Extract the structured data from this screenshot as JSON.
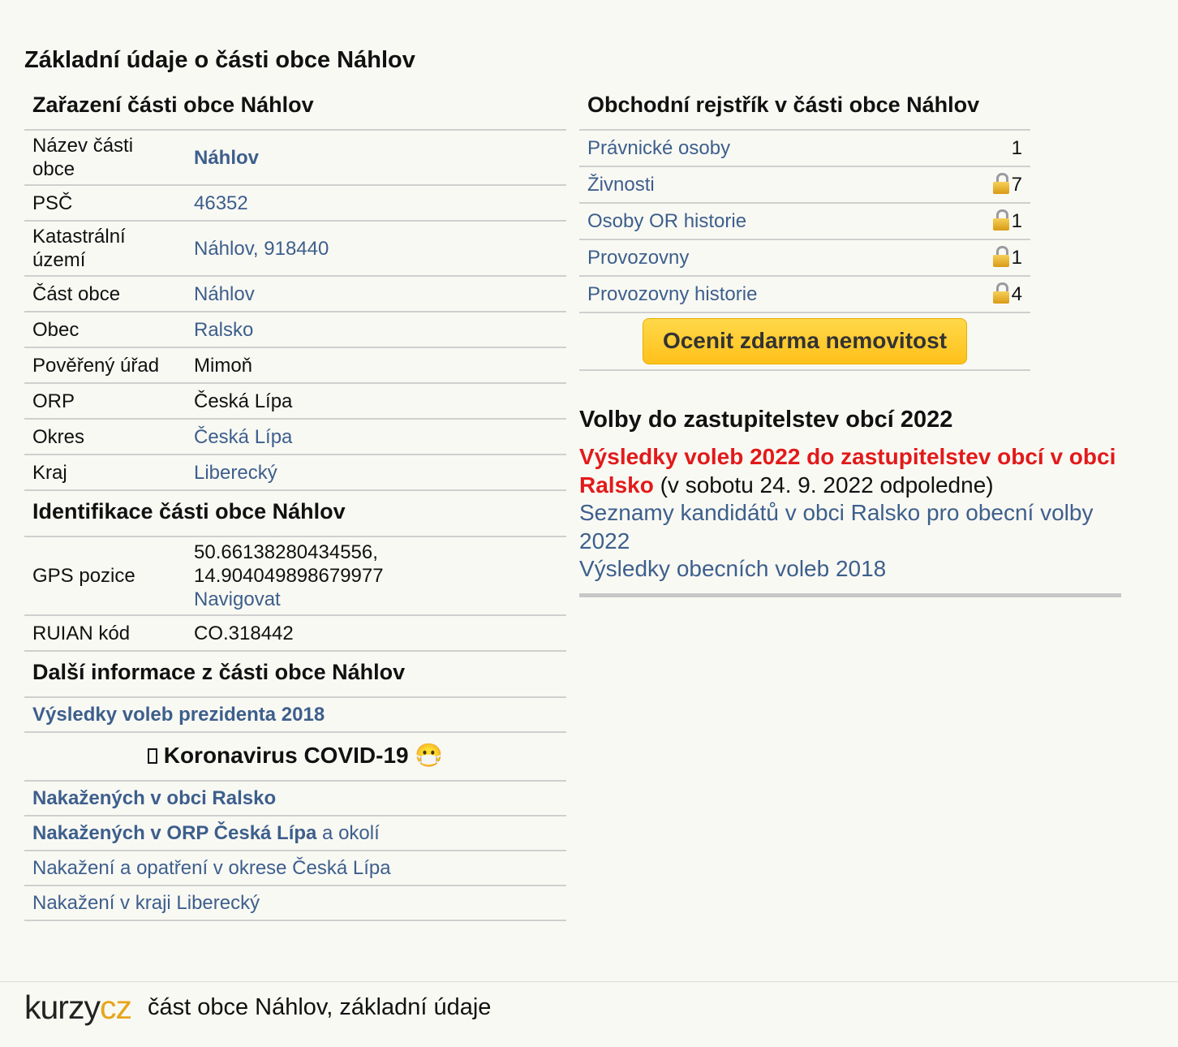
{
  "page_title": "Základní údaje o části obce Náhlov",
  "zarazeni": {
    "heading": "Zařazení části obce Náhlov",
    "rows": [
      {
        "key": "Název části obce",
        "value": "Náhlov"
      },
      {
        "key": "PSČ",
        "value": "46352"
      },
      {
        "key": "Katastrální území",
        "value": "Náhlov, 918440"
      },
      {
        "key": "Část obce",
        "value": "Náhlov"
      },
      {
        "key": "Obec",
        "value": "Ralsko"
      },
      {
        "key": "Pověřený úřad",
        "value": "Mimoň"
      },
      {
        "key": "ORP",
        "value": "Česká Lípa"
      },
      {
        "key": "Okres",
        "value": "Česká Lípa"
      },
      {
        "key": "Kraj",
        "value": "Liberecký"
      }
    ]
  },
  "identifikace": {
    "heading": "Identifikace části obce Náhlov",
    "gps_key": "GPS pozice",
    "gps_lat": "50.66138280434556,",
    "gps_lon": "14.904049898679977",
    "gps_link": "Navigovat",
    "ruian_key": "RUIAN kód",
    "ruian_value": "CO.318442"
  },
  "dalsi": {
    "heading": "Další informace z části obce Náhlov",
    "link_volby": "Výsledky voleb prezidenta 2018"
  },
  "covid": {
    "heading": "Koronavirus COVID-19",
    "mask_emoji": "😷",
    "link1": "Nakažených v obci Ralsko",
    "link2_bold": "Nakažených v ORP Česká Lípa",
    "link2_rest": " a okolí",
    "link3": "Nakažení a opatření v okrese Česká Lípa",
    "link4": "Nakažení v kraji Liberecký"
  },
  "rejstrik": {
    "heading": "Obchodní rejstřík v části obce Náhlov",
    "rows": [
      {
        "label": "Právnické osoby",
        "count": "1",
        "locked": false
      },
      {
        "label": "Živnosti",
        "count": "7",
        "locked": true
      },
      {
        "label": "Osoby OR historie",
        "count": "1",
        "locked": true
      },
      {
        "label": "Provozovny",
        "count": "1",
        "locked": true
      },
      {
        "label": "Provozovny historie",
        "count": "4",
        "locked": true
      }
    ],
    "button": "Ocenit zdarma nemovitost"
  },
  "volby": {
    "heading": "Volby do zastupitelstev obcí 2022",
    "red_link": "Výsledky voleb 2022 do zastupitelstev obcí v obci Ralsko",
    "red_note": " (v sobotu 24. 9. 2022 odpoledne)",
    "link_kandidati": "Seznamy kandidátů v obci Ralsko pro obecní volby 2022",
    "link_2018": "Výsledky obecních voleb 2018"
  },
  "footer": {
    "logo_a": "kurzy",
    "logo_b": "cz",
    "text": "část obce Náhlov, základní údaje"
  },
  "colors": {
    "link": "#3d5f8c",
    "red": "#e21a1a",
    "button": "#ffc11a",
    "logo_accent": "#e8a41b",
    "background": "#f9f9f4"
  }
}
